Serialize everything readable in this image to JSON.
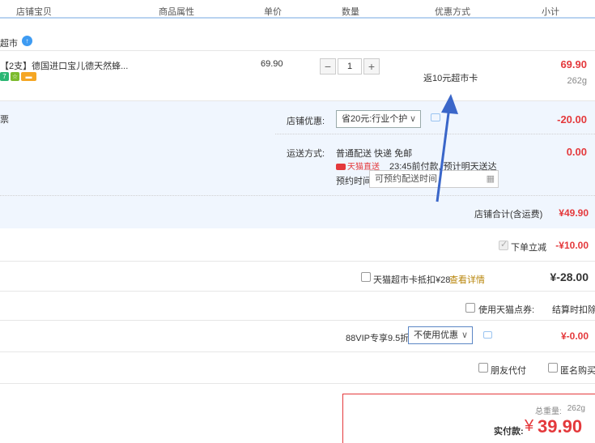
{
  "header": {
    "cols": [
      "店铺宝贝",
      "商品属性",
      "单价",
      "数量",
      "优惠方式",
      "小计"
    ]
  },
  "store": {
    "name": "超市"
  },
  "item": {
    "title": "【2支】德国进口宝儿德天然蜂...",
    "price": "69.90",
    "qty": "1",
    "promo": "返10元超市卡",
    "subtotal": "69.90",
    "weight": "262g"
  },
  "shop_block": {
    "left_fragment": "票",
    "discount_label": "店铺优惠:",
    "discount_select": "省20元:行业个护",
    "discount_value": "-20.00",
    "ship_label": "运送方式:",
    "ship_method": "普通配送 快递 免邮",
    "ship_badge": "天猫直送",
    "ship_note": "23:45前付款, 预计明天送达",
    "appt_label": "预约时间",
    "appt_placeholder": "可预约配送时间",
    "ship_value": "0.00"
  },
  "shop_total": {
    "label": "店铺合计(含运费)",
    "value": "¥49.90"
  },
  "rows": {
    "instant_off_label": "下单立减",
    "instant_off_value": "-¥10.00",
    "card_label": "天猫超市卡抵扣¥28",
    "card_link": "查看详情",
    "card_value": "¥-28.00",
    "points_label": "使用天猫点券:",
    "points_value": "结算时扣除",
    "vip_label": "88VIP专享9.5折",
    "vip_select": "不使用优惠",
    "vip_value": "¥-0.00",
    "friend_pay": "朋友代付",
    "anon_buy": "匿名购买"
  },
  "summary": {
    "weight_label": "总重量:",
    "weight_value": "262g",
    "pay_label": "实付款:",
    "currency": "¥",
    "pay_value": "39.90"
  },
  "colors": {
    "accent_red": "#e4393c",
    "arrow_blue": "#3a66c9",
    "panel_blue": "#f0f6fe"
  }
}
